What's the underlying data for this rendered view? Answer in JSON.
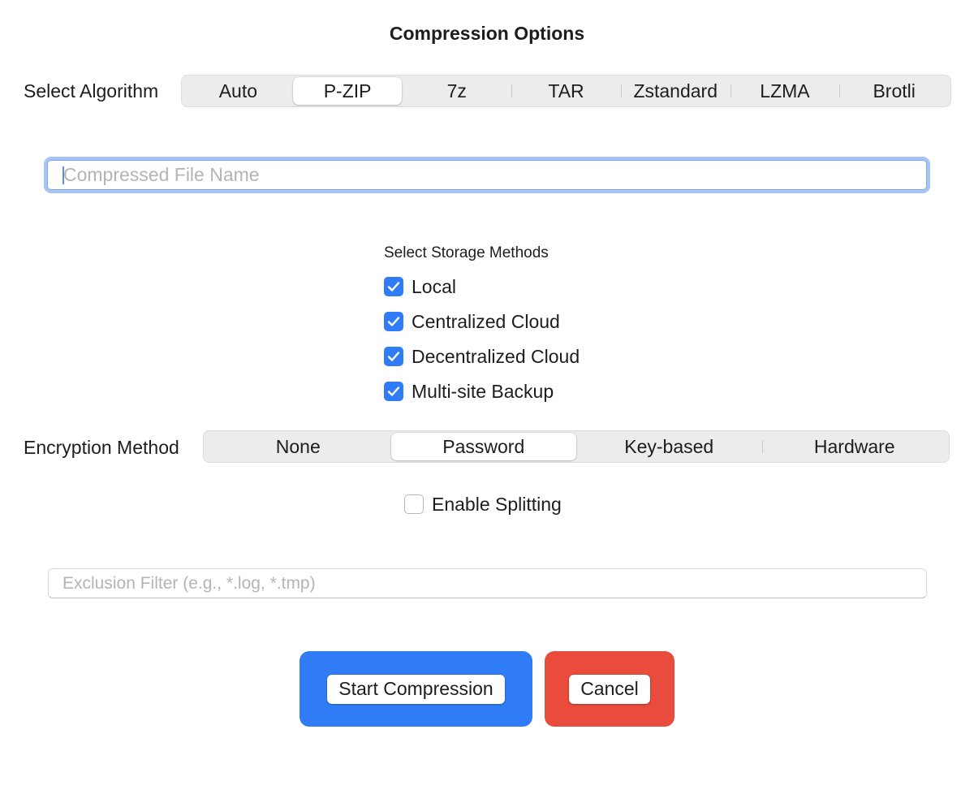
{
  "dialog": {
    "title": "Compression Options"
  },
  "algorithm": {
    "label": "Select Algorithm",
    "options": [
      "Auto",
      "P-ZIP",
      "7z",
      "TAR",
      "Zstandard",
      "LZMA",
      "Brotli"
    ],
    "selected": "P-ZIP"
  },
  "file_name": {
    "value": "",
    "placeholder": "Compressed File Name"
  },
  "storage": {
    "label": "Select Storage Methods",
    "options": [
      {
        "label": "Local",
        "checked": true
      },
      {
        "label": "Centralized Cloud",
        "checked": true
      },
      {
        "label": "Decentralized Cloud",
        "checked": true
      },
      {
        "label": "Multi-site Backup",
        "checked": true
      }
    ]
  },
  "encryption": {
    "label": "Encryption Method",
    "options": [
      "None",
      "Password",
      "Key-based",
      "Hardware"
    ],
    "selected": "Password"
  },
  "splitting": {
    "label": "Enable Splitting",
    "checked": false
  },
  "exclusion": {
    "value": "",
    "placeholder": "Exclusion Filter (e.g., *.log, *.tmp)"
  },
  "actions": {
    "start_label": "Start Compression",
    "cancel_label": "Cancel"
  },
  "colors": {
    "accent": "#2f7cf6",
    "start_button": "#2f7cf6",
    "cancel_button": "#e94b3c",
    "focus_ring": "#a7c4f4"
  },
  "icons": {
    "checkbox_checked": "checkmark-icon"
  }
}
